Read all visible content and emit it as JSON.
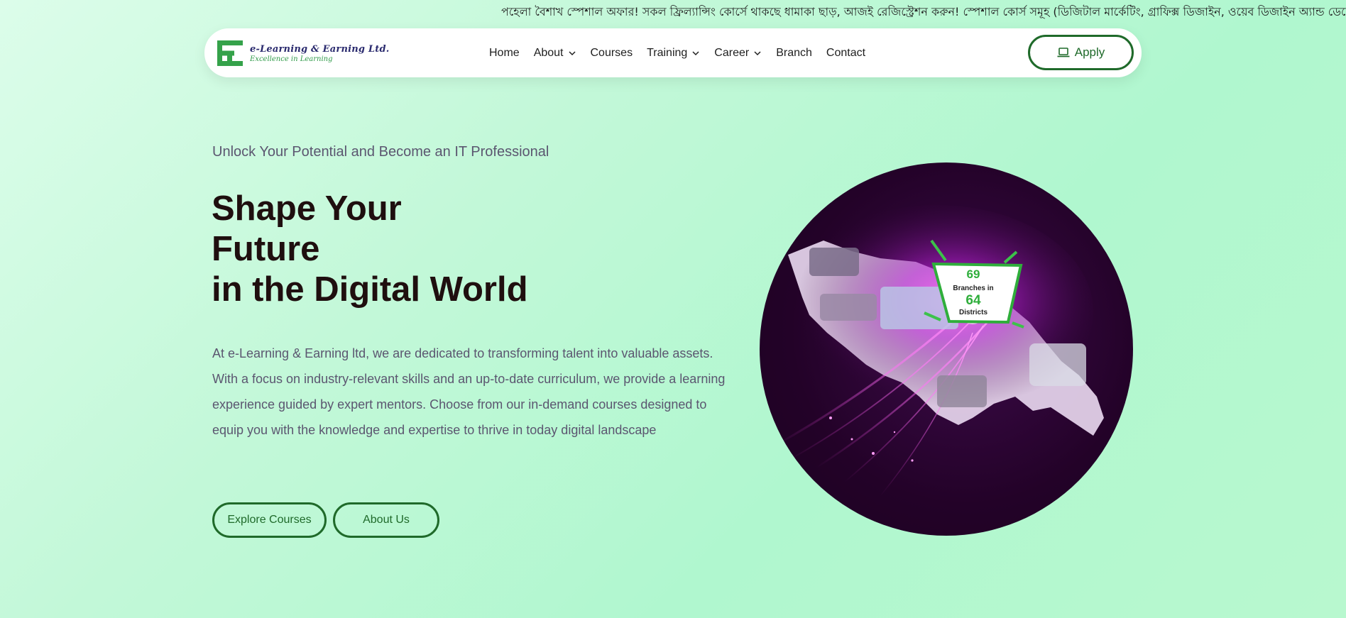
{
  "ticker": {
    "text": "পহেলা বৈশাখ স্পেশাল অফার! সকল ফ্রিল্যান্সিং কোর্সে থাকছে ধামাকা ছাড়, আজই রেজিস্ট্রেশন করুন! স্পেশাল কোর্স সমূহ (ডিজিটাল মার্কেটিং, গ্রাফিক্স ডিজাইন, ওয়েব ডিজাইন অ্যান্ড ডেভেলপমেন্ট)"
  },
  "brand": {
    "name": "e-Learning & Earning Ltd.",
    "tagline": "Excellence in Learning",
    "color_green": "#35a24a",
    "color_navy": "#2a2a6e"
  },
  "nav": {
    "items": [
      {
        "label": "Home",
        "has_dropdown": false
      },
      {
        "label": "About",
        "has_dropdown": true
      },
      {
        "label": "Courses",
        "has_dropdown": false
      },
      {
        "label": "Training",
        "has_dropdown": true
      },
      {
        "label": "Career",
        "has_dropdown": true
      },
      {
        "label": "Branch",
        "has_dropdown": false
      },
      {
        "label": "Contact",
        "has_dropdown": false
      }
    ],
    "apply_label": "Apply",
    "apply_icon": "laptop-icon"
  },
  "hero": {
    "eyebrow": "Unlock Your Potential and Become an IT Professional",
    "headline_line1": "Shape Your",
    "headline_line2": "Future",
    "headline_line3": "in the Digital World",
    "lead": "At e-Learning & Earning ltd, we are dedicated to transforming talent into valuable assets. With a focus on industry-relevant skills and an up-to-date curriculum, we provide a learning experience guided by expert mentors. Choose from our in-demand courses designed to equip you with the knowledge and expertise to thrive in today digital landscape",
    "explore_label": "Explore Courses",
    "about_label": "About Us"
  },
  "hero_image": {
    "badge_number_top": "69",
    "badge_text_mid": "Branches in",
    "badge_number_bottom": "64",
    "badge_text_bottom": "Districts"
  },
  "colors": {
    "accent": "#1f6a2a",
    "heading": "#1f0f0f",
    "body_text": "#5b5670",
    "circle_bg": "#230228",
    "glow": "#c630e0"
  }
}
